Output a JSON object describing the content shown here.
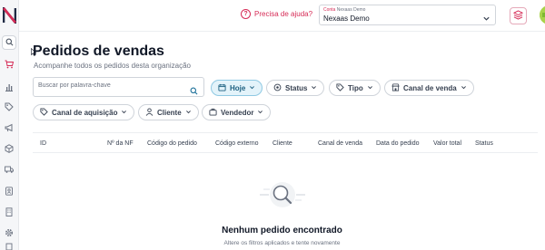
{
  "app": {
    "logo": "N"
  },
  "sidebar": {
    "items": [
      {
        "icon": "search-icon",
        "active": true
      },
      {
        "icon": "cart-icon"
      },
      {
        "icon": "bar-chart-icon"
      },
      {
        "icon": "tag-icon"
      },
      {
        "icon": "megaphone-icon"
      },
      {
        "icon": "box-icon"
      },
      {
        "icon": "truck-icon"
      },
      {
        "icon": "contact-card-icon"
      },
      {
        "icon": "building-icon"
      },
      {
        "icon": "gear-icon"
      },
      {
        "icon": "report-icon"
      }
    ]
  },
  "topbar": {
    "help_text": "Precisa de ajuda?",
    "account": {
      "caption_label": "Conta",
      "caption_value": "Nexaas Demo",
      "value": "Nexaas Demo"
    }
  },
  "page": {
    "title": "Pedidos de vendas",
    "subtitle": "Acompanhe todos os pedidos desta organização"
  },
  "search": {
    "placeholder": "Buscar por palavra-chave"
  },
  "filters": {
    "hoje": "Hoje",
    "status": "Status",
    "tipo": "Tipo",
    "canal_venda": "Canal de venda",
    "canal_aquisicao": "Canal de aquisição",
    "cliente": "Cliente",
    "vendedor": "Vendedor"
  },
  "table": {
    "columns": [
      "ID",
      "Nº da NF",
      "Código do pedido",
      "Código externo",
      "Cliente",
      "Canal de venda",
      "Data do pedido",
      "Valor total",
      "Status"
    ]
  },
  "empty": {
    "title": "Nenhum pedido encontrado",
    "subtitle": "Altere os filtros aplicados e tente novamente"
  },
  "colors": {
    "accent": "#d62b56",
    "active_chip": "#e3f3fa",
    "avatar": "#a9d34a"
  }
}
